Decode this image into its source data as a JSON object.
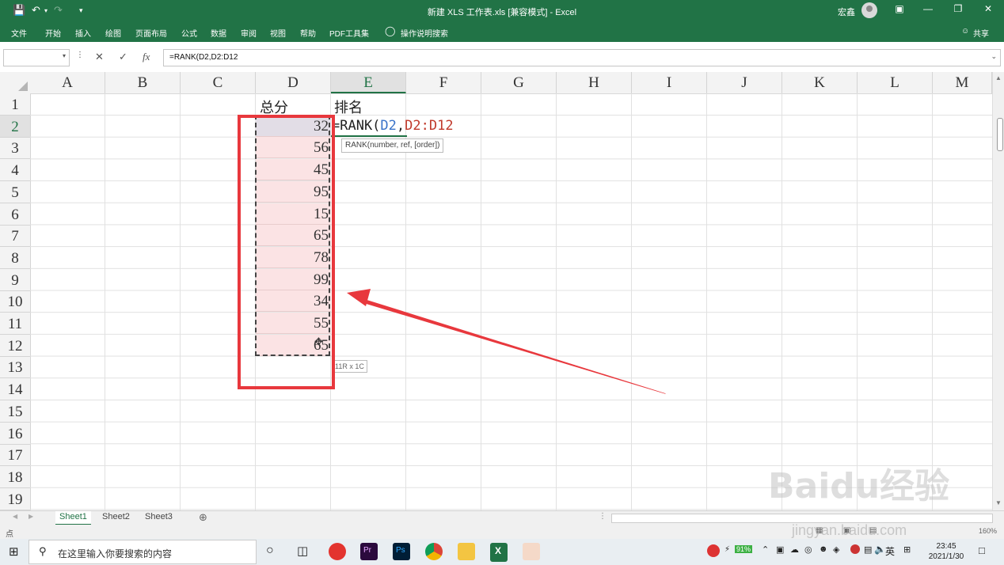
{
  "app": {
    "title": "新建 XLS 工作表.xls [兼容模式] - Excel",
    "user": "宏鑫",
    "brand_color": "#217346"
  },
  "ribbon_tabs": [
    "文件",
    "开始",
    "插入",
    "绘图",
    "页面布局",
    "公式",
    "数据",
    "审阅",
    "视图",
    "帮助",
    "PDF工具集",
    "操作说明搜索"
  ],
  "share_label": "共享",
  "formula_bar": {
    "name_box": "",
    "fx_label": "fx",
    "formula": "=RANK(D2,D2:D12"
  },
  "columns": [
    "A",
    "B",
    "C",
    "D",
    "E",
    "F",
    "G",
    "H",
    "I",
    "J",
    "K",
    "L",
    "M"
  ],
  "rows": [
    "1",
    "2",
    "3",
    "4",
    "5",
    "6",
    "7",
    "8",
    "9",
    "10",
    "11",
    "12",
    "13",
    "14",
    "15",
    "16",
    "17",
    "18",
    "19"
  ],
  "cells": {
    "D1": "总分",
    "E1": "排名",
    "D_values": [
      "32",
      "56",
      "45",
      "95",
      "15",
      "65",
      "78",
      "99",
      "34",
      "55",
      "65"
    ]
  },
  "edit_formula": {
    "prefix": "=RANK(",
    "arg1": "D2",
    "comma": ",",
    "arg2": "D2:D12"
  },
  "tooltip": "RANK(number, ref, [order])",
  "range_tip": "11R x 1C",
  "sheets": [
    "Sheet1",
    "Sheet2",
    "Sheet3"
  ],
  "status": {
    "mode": "点",
    "zoom": "160%"
  },
  "taskbar": {
    "search_placeholder": "在这里输入你要搜索的内容",
    "battery": "91%",
    "ime": "英",
    "time": "23:45",
    "date": "2021/1/30"
  },
  "watermark": {
    "logo": "Baidu经验",
    "url": "jingyan.baidu.com"
  }
}
